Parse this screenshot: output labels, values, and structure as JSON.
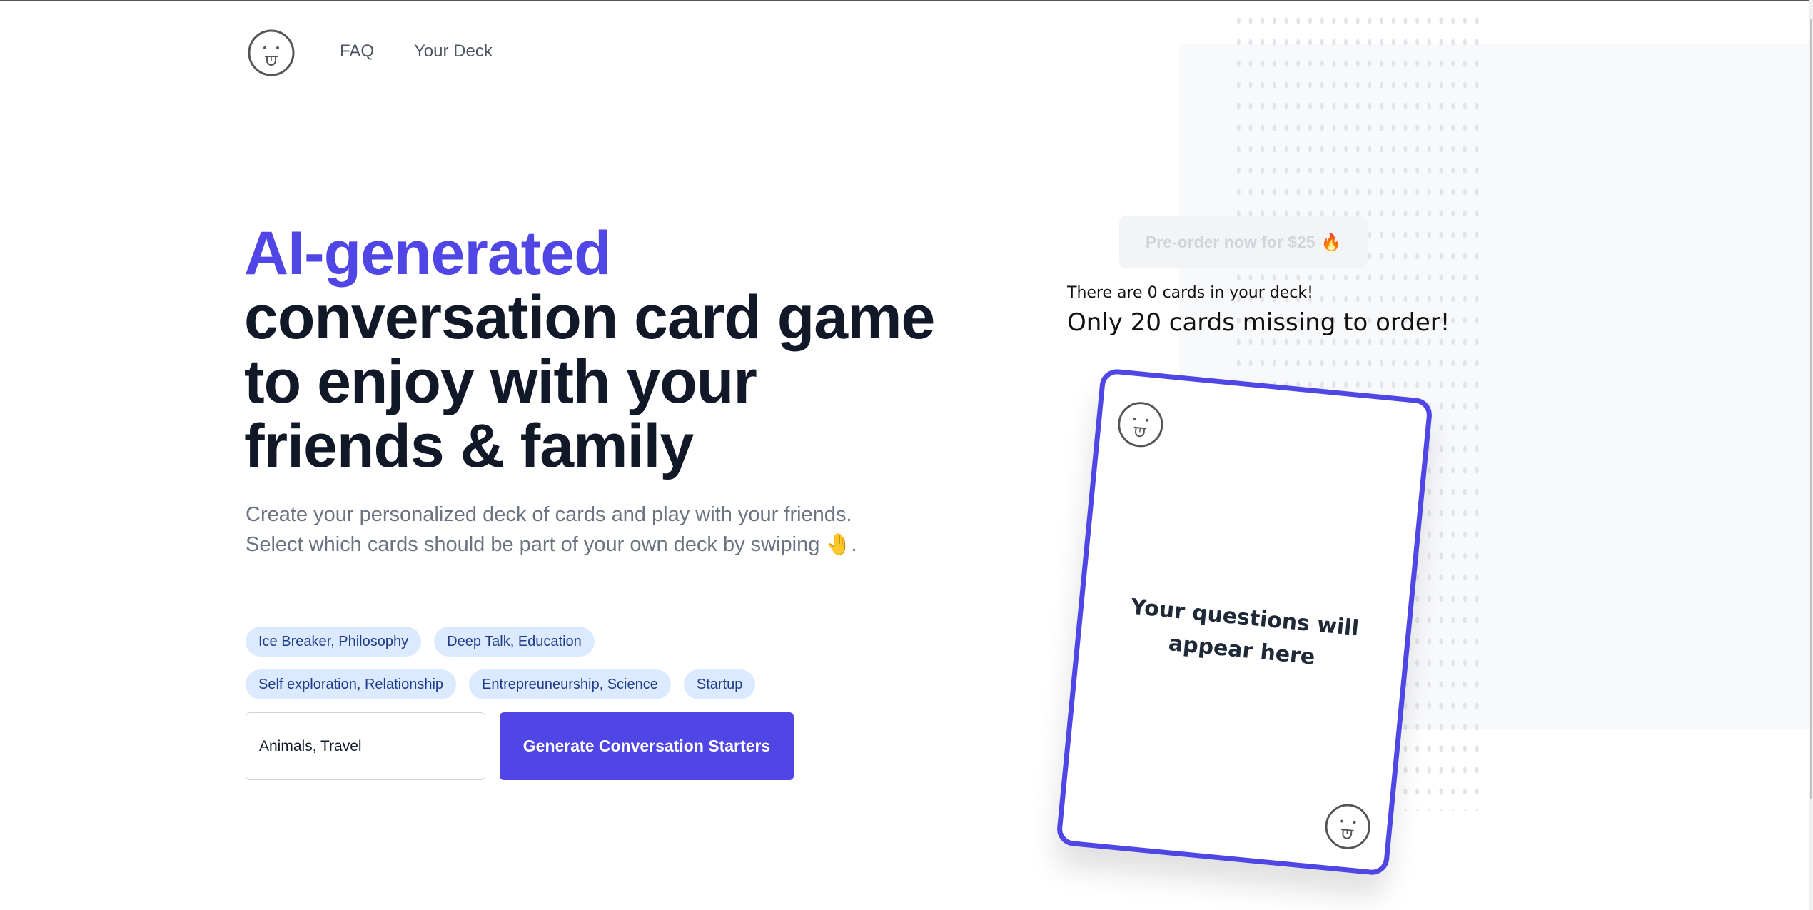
{
  "header": {
    "logo_icon": "tongue-out-face-icon",
    "nav": [
      {
        "label": "FAQ"
      },
      {
        "label": "Your Deck"
      }
    ]
  },
  "hero": {
    "title_accent": "AI-generated",
    "title_rest": "conversation card game to enjoy with your friends & family",
    "subtitle_line1": "Create your personalized deck of cards and play with your friends.",
    "subtitle_line2": "Select which cards should be part of your own deck by swiping",
    "subtitle_emoji": "🤚",
    "subtitle_end": "."
  },
  "topics": {
    "tags": [
      [
        "Ice Breaker, Philosophy",
        "Deep Talk, Education"
      ],
      [
        "Self exploration, Relationship",
        "Entrepreuneurship, Science",
        "Startup"
      ]
    ],
    "input_value": "Animals, Travel",
    "generate_label": "Generate Conversation Starters"
  },
  "deck": {
    "preorder_label": "Pre-order now for $25",
    "preorder_emoji": "🔥",
    "count_text": "There are 0 cards in your deck!",
    "missing_text": "Only 20 cards missing to order!",
    "card_count": 0,
    "cards_missing": 20
  },
  "card": {
    "placeholder_text": "Your questions will appear here",
    "corner_icon": "tongue-out-face-icon"
  },
  "colors": {
    "accent": "#4f46e5",
    "heading": "#111827",
    "muted": "#6b7280",
    "tag_bg": "#dbeafe",
    "tag_text": "#1e3a8a"
  }
}
